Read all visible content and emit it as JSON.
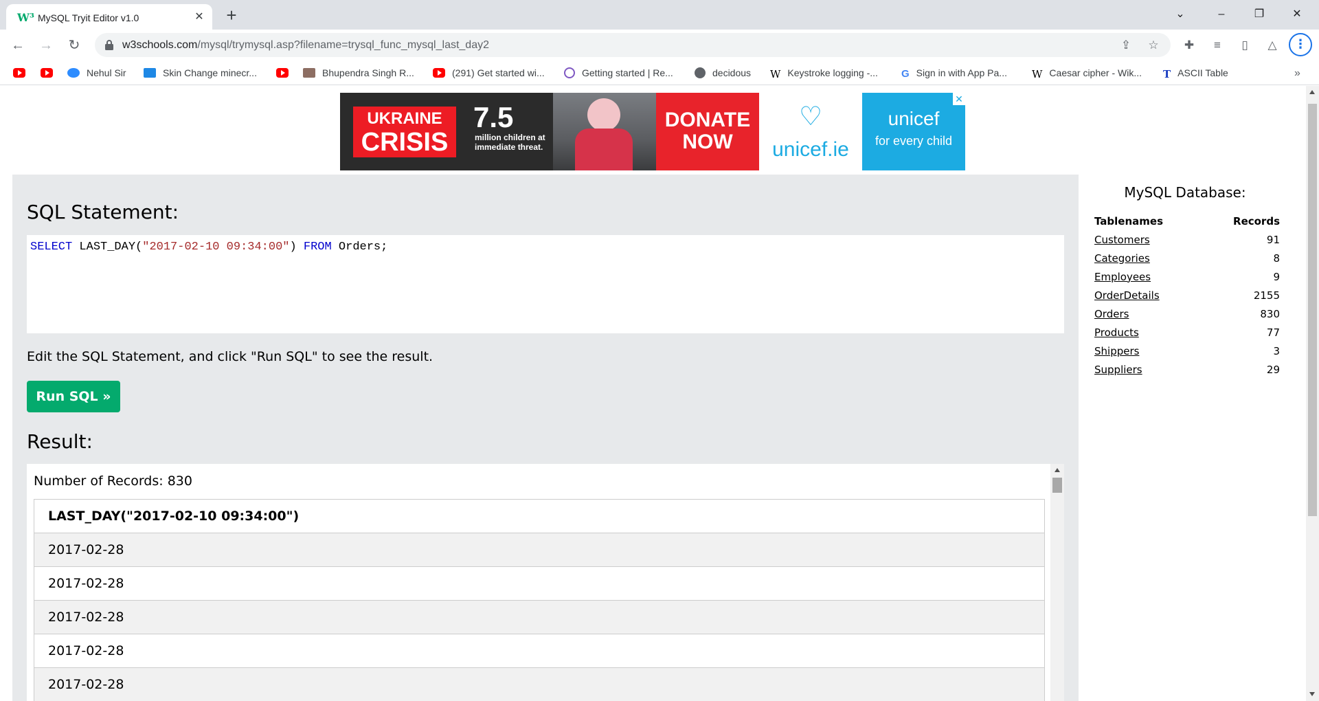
{
  "browser": {
    "tab_title": "MySQL Tryit Editor v1.0",
    "url_host": "w3schools.com",
    "url_path": "/mysql/trymysql.asp?filename=trysql_func_mysql_last_day2",
    "bookmarks": [
      {
        "label": "",
        "icon": "youtube-icon"
      },
      {
        "label": "",
        "icon": "youtube-icon"
      },
      {
        "label": "Nehul Sir",
        "icon": "zoom-icon"
      },
      {
        "label": "Skin Change minecr...",
        "icon": "tl-icon"
      },
      {
        "label": "",
        "icon": "youtube-icon"
      },
      {
        "label": "Bhupendra Singh R...",
        "icon": "thumbnail-icon"
      },
      {
        "label": "(291) Get started wi...",
        "icon": "youtube-icon"
      },
      {
        "label": "Getting started | Re...",
        "icon": "react-icon"
      },
      {
        "label": "decidous",
        "icon": "globe-icon"
      },
      {
        "label": "Keystroke logging -...",
        "icon": "wikipedia-icon"
      },
      {
        "label": "Sign in with App Pa...",
        "icon": "google-icon"
      },
      {
        "label": "Caesar cipher - Wik...",
        "icon": "wikipedia-icon"
      },
      {
        "label": "ASCII Table",
        "icon": "t-icon"
      }
    ]
  },
  "ad": {
    "ukraine_line1": "UKRAINE",
    "ukraine_line2": "CRISIS",
    "number": "7.5",
    "number_sub": "million children at immediate threat.",
    "donate": "DONATE NOW",
    "unicef_ie": "unicef.ie",
    "unicef": "unicef",
    "unicef_tagline": "for every child"
  },
  "editor": {
    "heading": "SQL Statement:",
    "sql_kw1": "SELECT",
    "sql_fn": " LAST_DAY(",
    "sql_str": "\"2017-02-10 09:34:00\"",
    "sql_close": ") ",
    "sql_kw2": "FROM",
    "sql_rest": " Orders;",
    "instruction": "Edit the SQL Statement, and click \"Run SQL\" to see the result.",
    "run_label": "Run SQL »"
  },
  "result": {
    "heading": "Result:",
    "record_count": "Number of Records: 830",
    "column": "LAST_DAY(\"2017-02-10 09:34:00\")",
    "rows": [
      "2017-02-28",
      "2017-02-28",
      "2017-02-28",
      "2017-02-28",
      "2017-02-28"
    ]
  },
  "database": {
    "title": "MySQL Database:",
    "col_name": "Tablenames",
    "col_records": "Records",
    "tables": [
      {
        "name": "Customers",
        "records": "91"
      },
      {
        "name": "Categories",
        "records": "8"
      },
      {
        "name": "Employees",
        "records": "9"
      },
      {
        "name": "OrderDetails",
        "records": "2155"
      },
      {
        "name": "Orders",
        "records": "830"
      },
      {
        "name": "Products",
        "records": "77"
      },
      {
        "name": "Shippers",
        "records": "3"
      },
      {
        "name": "Suppliers",
        "records": "29"
      }
    ]
  },
  "colors": {
    "run_button": "#04aa6d",
    "panel_bg": "#e7e9eb",
    "sql_keyword": "#0000cd",
    "sql_string": "#a52a2a"
  }
}
